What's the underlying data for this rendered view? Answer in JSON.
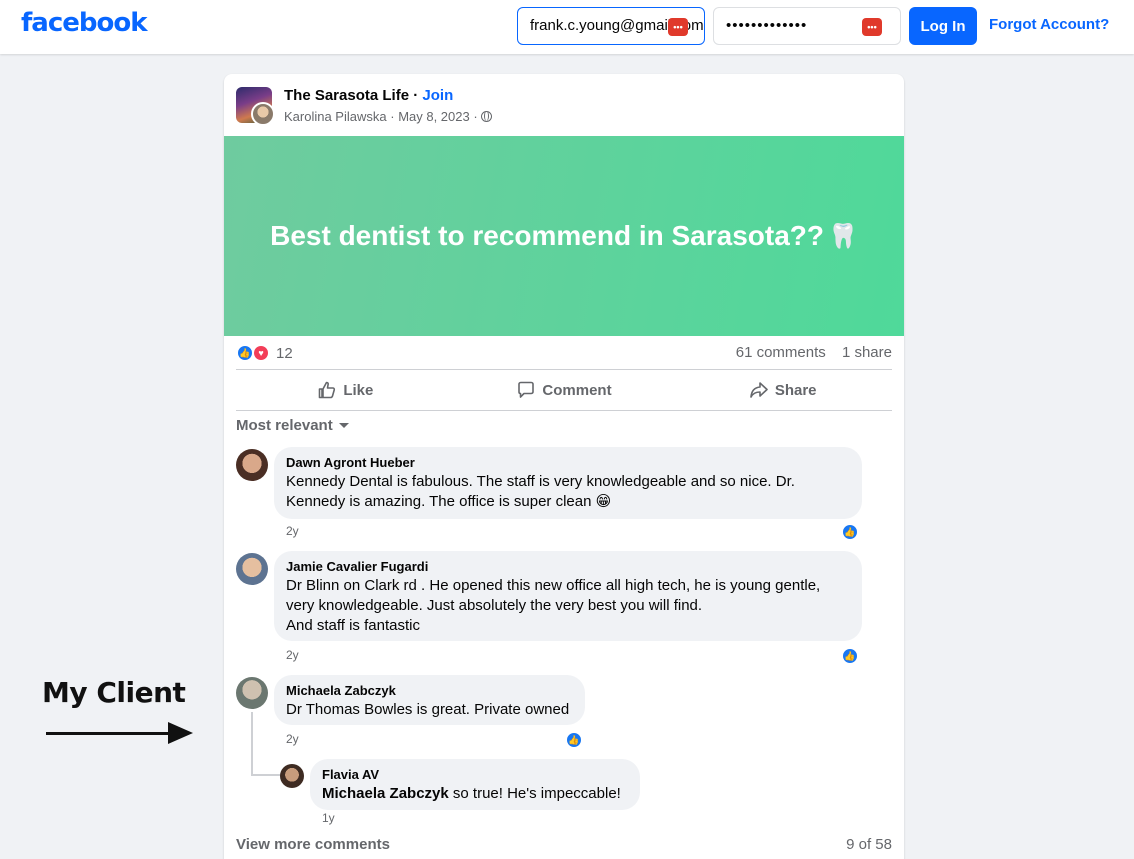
{
  "header": {
    "logo": "facebook",
    "email_value": "frank.c.young@gmail.com",
    "password_mask": "•••••••••••••",
    "login_label": "Log In",
    "forgot_label": "Forgot Account?",
    "password_manager_icon": "•••"
  },
  "post": {
    "group_name": "The Sarasota Life",
    "join_label": "Join",
    "author": "Karolina Pilawska",
    "date": "May 8, 2023",
    "text": "Best dentist to recommend in Sarasota??",
    "emoji": "🦷",
    "reaction_count": "12",
    "comments_count": "61 comments",
    "shares_count": "1 share"
  },
  "actions": {
    "like": "Like",
    "comment": "Comment",
    "share": "Share"
  },
  "sort_label": "Most relevant",
  "comments": [
    {
      "author": "Dawn Agront Hueber",
      "text_line1": "Kennedy Dental is fabulous. The staff is very knowledgeable and so nice. Dr.",
      "text_line2": "Kennedy is amazing. The office is super clean 😁",
      "time": "2y"
    },
    {
      "author": "Jamie Cavalier Fugardi",
      "text_line1": "Dr Blinn on Clark rd . He opened this new office all high tech, he is young gentle,",
      "text_line2": "very knowledgeable. Just absolutely the very best you will find.",
      "text_line3": "And staff is fantastic",
      "time": "2y"
    },
    {
      "author": "Michaela Zabczyk",
      "text_line1": "Dr Thomas Bowles is great. Private owned",
      "time": "2y"
    }
  ],
  "reply": {
    "author": "Flavia AV",
    "mention": "Michaela Zabczyk",
    "text": " so true! He's impeccable!",
    "time": "1y"
  },
  "footer": {
    "view_more": "View more comments",
    "paging": "9 of 58"
  },
  "annotation": {
    "label": "My Client"
  },
  "colors": {
    "brand": "#0866ff",
    "like_blue": "#1877f2",
    "love_red": "#f33e58",
    "banner_start": "#6fcb9f",
    "banner_end": "#4fd99a"
  }
}
